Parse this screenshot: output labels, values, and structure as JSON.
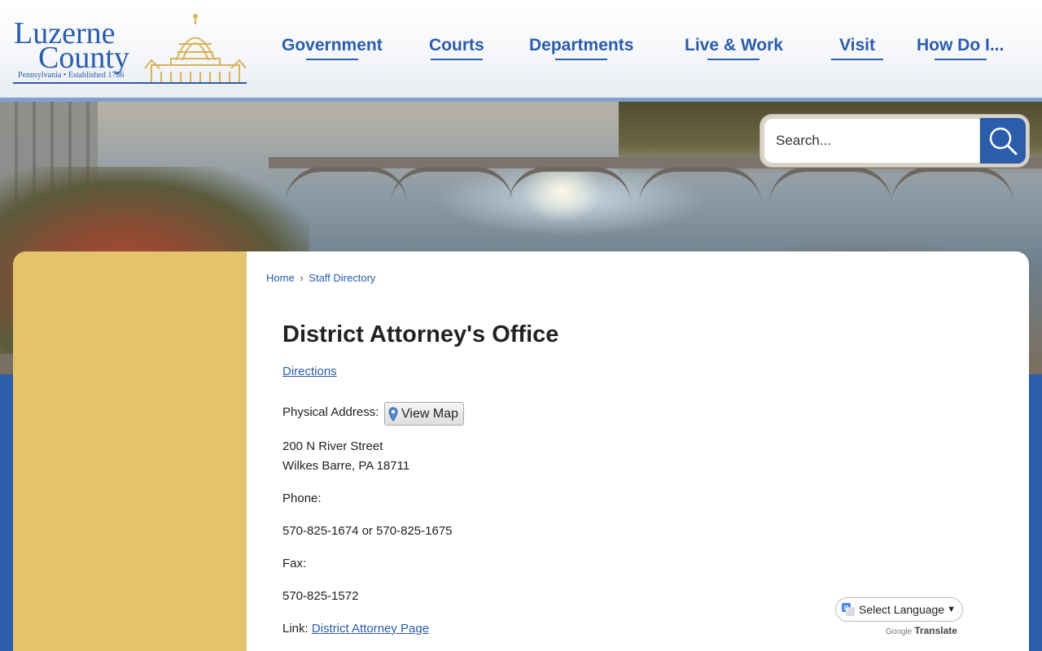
{
  "logo": {
    "line1": "Luzerne",
    "line2": "County",
    "subtitle": "Pennsylvania • Established 1786"
  },
  "nav": [
    {
      "label": "Government"
    },
    {
      "label": "Courts"
    },
    {
      "label": "Departments"
    },
    {
      "label": "Live & Work"
    },
    {
      "label": "Visit"
    },
    {
      "label": "How Do I..."
    }
  ],
  "search": {
    "placeholder": "Search...",
    "icon": "search-icon"
  },
  "breadcrumb": {
    "home": "Home",
    "separator": "›",
    "current": "Staff Directory"
  },
  "office": {
    "title": "District Attorney's Office",
    "directions_link": "Directions",
    "physical_address_label": "Physical Address:",
    "view_map_label": "View Map",
    "address_line1": "200 N River Street",
    "address_line2": "Wilkes Barre, PA 18711",
    "phone_label": "Phone:",
    "phone_value": "570-825-1674 or 570-825-1675",
    "fax_label": "Fax:",
    "fax_value": "570-825-1572",
    "link_label": "Link:",
    "link_text": "District Attorney Page"
  },
  "translate": {
    "select_label": "Select Language",
    "powered_by": "Google",
    "translate_word": "Translate"
  },
  "colors": {
    "brand_blue": "#2b5dab",
    "sidebar_gold": "#e3c46c",
    "logo_gold": "#d9b45a"
  }
}
